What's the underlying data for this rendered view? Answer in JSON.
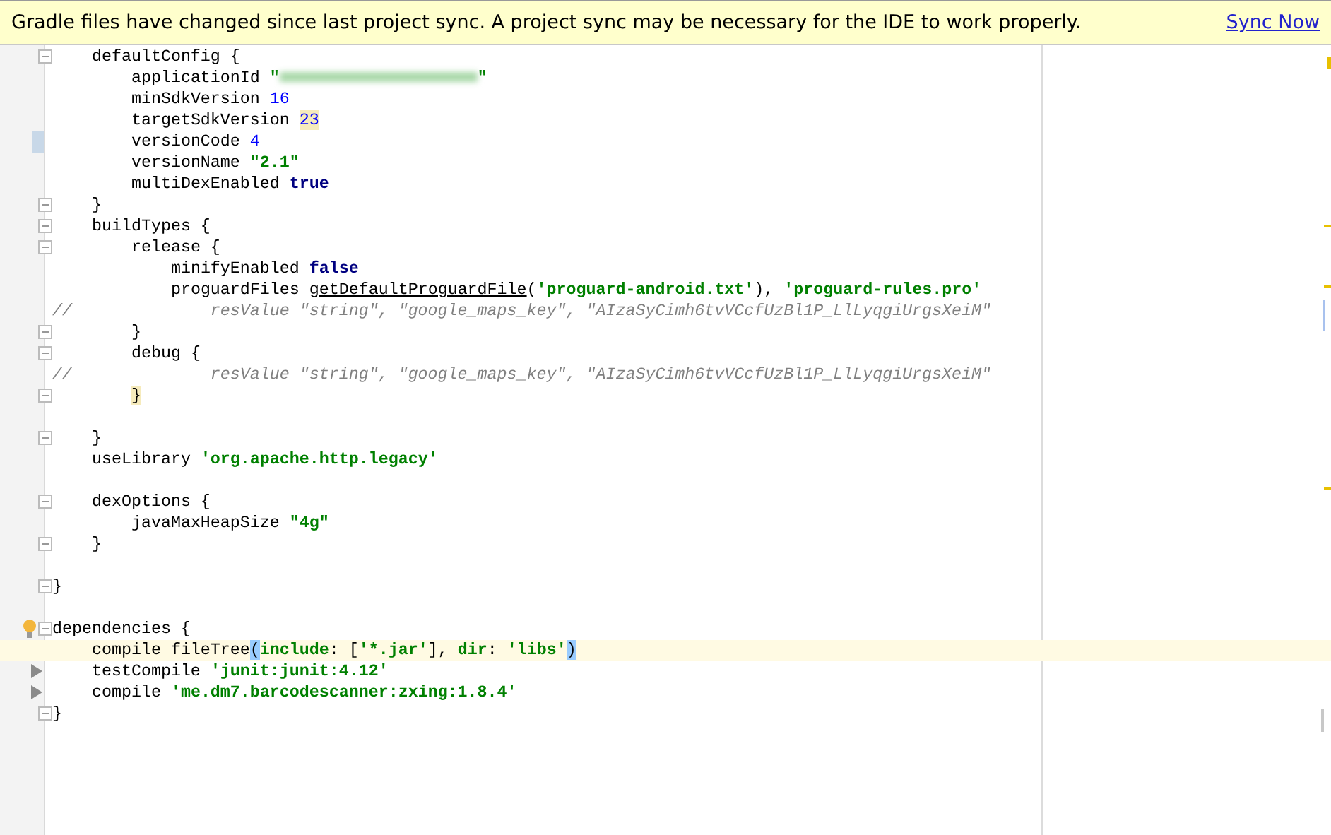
{
  "banner": {
    "message": "Gradle files have changed since last project sync. A project sync may be necessary for the IDE to work properly.",
    "link": "Sync Now"
  },
  "lines": [
    {
      "current": false,
      "markers": [
        {
          "kind": "fold"
        }
      ],
      "tokens": [
        {
          "kind": "plain",
          "text": "    defaultConfig {"
        }
      ]
    },
    {
      "current": false,
      "tokens": [
        {
          "kind": "plain",
          "text": "        applicationId "
        },
        {
          "kind": "string",
          "text": "\""
        },
        {
          "kind": "redacted"
        },
        {
          "kind": "string",
          "text": "\""
        }
      ]
    },
    {
      "current": false,
      "tokens": [
        {
          "kind": "plain",
          "text": "        minSdkVersion "
        },
        {
          "kind": "number",
          "text": "16"
        }
      ]
    },
    {
      "current": false,
      "tokens": [
        {
          "kind": "plain",
          "text": "        targetSdkVersion "
        },
        {
          "kind": "number_warn",
          "text": "23"
        }
      ]
    },
    {
      "current": false,
      "markers": [
        {
          "kind": "change"
        }
      ],
      "tokens": [
        {
          "kind": "plain",
          "text": "        versionCode "
        },
        {
          "kind": "number",
          "text": "4"
        }
      ]
    },
    {
      "current": false,
      "tokens": [
        {
          "kind": "plain",
          "text": "        versionName "
        },
        {
          "kind": "string",
          "text": "\"2.1\""
        }
      ]
    },
    {
      "current": false,
      "tokens": [
        {
          "kind": "plain",
          "text": "        multiDexEnabled "
        },
        {
          "kind": "keyword",
          "text": "true"
        }
      ]
    },
    {
      "current": false,
      "markers": [
        {
          "kind": "fold"
        }
      ],
      "tokens": [
        {
          "kind": "plain",
          "text": "    }"
        }
      ]
    },
    {
      "current": false,
      "markers": [
        {
          "kind": "fold"
        }
      ],
      "tokens": [
        {
          "kind": "plain",
          "text": "    buildTypes {"
        }
      ]
    },
    {
      "current": false,
      "markers": [
        {
          "kind": "fold"
        }
      ],
      "tokens": [
        {
          "kind": "plain",
          "text": "        release {"
        }
      ]
    },
    {
      "current": false,
      "tokens": [
        {
          "kind": "plain",
          "text": "            minifyEnabled "
        },
        {
          "kind": "keyword",
          "text": "false"
        }
      ]
    },
    {
      "current": false,
      "tokens": [
        {
          "kind": "plain",
          "text": "            proguardFiles "
        },
        {
          "kind": "method",
          "text": "getDefaultProguardFile"
        },
        {
          "kind": "plain",
          "text": "("
        },
        {
          "kind": "string",
          "text": "'proguard-android.txt'"
        },
        {
          "kind": "plain",
          "text": "), "
        },
        {
          "kind": "string",
          "text": "'proguard-rules.pro'"
        }
      ]
    },
    {
      "current": false,
      "tokens": [
        {
          "kind": "comment",
          "text": "//              resValue \"string\", \"google_maps_key\", \"AIzaSyCimh6tvVCcfUzBl1P_LlLyqgiUrgsXeiM\""
        }
      ]
    },
    {
      "current": false,
      "markers": [
        {
          "kind": "fold"
        }
      ],
      "tokens": [
        {
          "kind": "plain",
          "text": "        }"
        }
      ]
    },
    {
      "current": false,
      "markers": [
        {
          "kind": "fold"
        }
      ],
      "tokens": [
        {
          "kind": "plain",
          "text": "        debug {"
        }
      ]
    },
    {
      "current": false,
      "tokens": [
        {
          "kind": "comment",
          "text": "//              resValue \"string\", \"google_maps_key\", \"AIzaSyCimh6tvVCcfUzBl1P_LlLyqgiUrgsXeiM\""
        }
      ]
    },
    {
      "current": false,
      "markers": [
        {
          "kind": "fold"
        }
      ],
      "tokens": [
        {
          "kind": "brace_match",
          "text": "        }"
        }
      ]
    },
    {
      "current": false
    },
    {
      "current": false,
      "markers": [
        {
          "kind": "fold"
        }
      ],
      "tokens": [
        {
          "kind": "plain",
          "text": "    }"
        }
      ]
    },
    {
      "current": false,
      "tokens": [
        {
          "kind": "plain",
          "text": "    useLibrary "
        },
        {
          "kind": "string",
          "text": "'org.apache.http.legacy'"
        }
      ]
    },
    {
      "current": false
    },
    {
      "current": false,
      "markers": [
        {
          "kind": "fold"
        }
      ],
      "tokens": [
        {
          "kind": "plain",
          "text": "    dexOptions {"
        }
      ]
    },
    {
      "current": false,
      "tokens": [
        {
          "kind": "plain",
          "text": "        javaMaxHeapSize "
        },
        {
          "kind": "string",
          "text": "\"4g\""
        }
      ]
    },
    {
      "current": false,
      "markers": [
        {
          "kind": "fold"
        }
      ],
      "tokens": [
        {
          "kind": "plain",
          "text": "    }"
        }
      ]
    },
    {
      "current": false
    },
    {
      "current": false,
      "markers": [
        {
          "kind": "fold"
        }
      ],
      "tokens": [
        {
          "kind": "plain",
          "text": "}"
        }
      ]
    },
    {
      "current": false
    },
    {
      "current": false,
      "markers": [
        {
          "kind": "bulb"
        },
        {
          "kind": "fold"
        }
      ],
      "tokens": [
        {
          "kind": "plain",
          "text": "dependencies {"
        }
      ]
    },
    {
      "current": true,
      "tokens": [
        {
          "kind": "plain",
          "text": "    compile fileTree"
        },
        {
          "kind": "paren_match",
          "text": "("
        },
        {
          "kind": "string",
          "text": "include"
        },
        {
          "kind": "plain",
          "text": ": ["
        },
        {
          "kind": "string",
          "text": "'*.jar'"
        },
        {
          "kind": "plain",
          "text": "], "
        },
        {
          "kind": "string",
          "text": "dir"
        },
        {
          "kind": "plain",
          "text": ": "
        },
        {
          "kind": "string",
          "text": "'libs'"
        },
        {
          "kind": "paren_match",
          "text": ")"
        }
      ]
    },
    {
      "current": false,
      "markers": [
        {
          "kind": "run"
        }
      ],
      "tokens": [
        {
          "kind": "plain",
          "text": "    testCompile "
        },
        {
          "kind": "string",
          "text": "'junit:junit:4.12'"
        }
      ]
    },
    {
      "current": false,
      "markers": [
        {
          "kind": "run"
        }
      ],
      "tokens": [
        {
          "kind": "plain",
          "text": "    compile "
        },
        {
          "kind": "string",
          "text": "'me.dm7.barcodescanner:zxing:1.8.4'"
        }
      ]
    },
    {
      "current": false,
      "markers": [
        {
          "kind": "fold"
        }
      ],
      "tokens": [
        {
          "kind": "plain",
          "text": "}"
        }
      ]
    }
  ]
}
